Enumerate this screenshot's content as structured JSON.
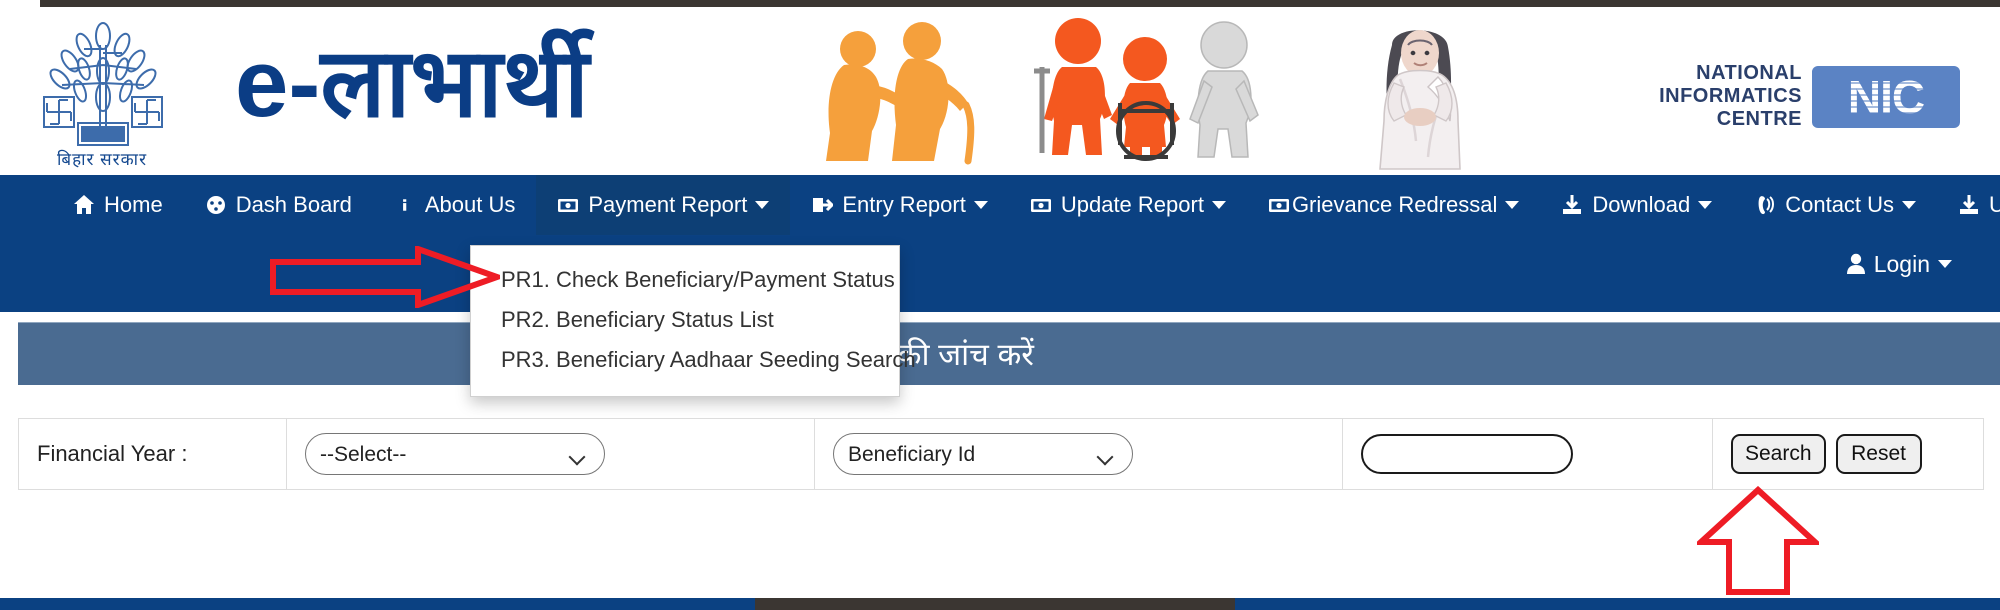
{
  "site": {
    "emblem_caption": "बिहार  सरकार",
    "brand_prefix": "e",
    "brand_dash": "-",
    "brand_hindi": "लाभार्थी",
    "nic_line1": "NATIONAL",
    "nic_line2": "INFORMATICS",
    "nic_line3": "CENTRE",
    "nic_mark": "NIC"
  },
  "nav": {
    "items": [
      {
        "label": "Home",
        "icon": "home-icon",
        "caret": false,
        "active": false
      },
      {
        "label": "Dash Board",
        "icon": "dashboard-icon",
        "caret": false,
        "active": false
      },
      {
        "label": "About Us",
        "icon": "info-icon",
        "caret": false,
        "active": false
      },
      {
        "label": "Payment Report",
        "icon": "money-icon",
        "caret": true,
        "active": true
      },
      {
        "label": "Entry Report",
        "icon": "signin-icon",
        "caret": true,
        "active": false
      },
      {
        "label": "Update Report",
        "icon": "money-icon",
        "caret": true,
        "active": false
      },
      {
        "label": "Grievance Redressal",
        "icon": "money-icon",
        "caret": true,
        "active": false
      },
      {
        "label": "Download",
        "icon": "download-icon",
        "caret": true,
        "active": false
      },
      {
        "label": "Contact Us",
        "icon": "phone-icon",
        "caret": true,
        "active": false
      },
      {
        "label": "User Manual",
        "icon": "download-icon",
        "caret": true,
        "active": false
      }
    ],
    "login_label": "Login",
    "login_icon": "user-icon"
  },
  "dropdown": {
    "open_for": "Payment Report",
    "items": [
      "PR1. Check Beneficiary/Payment Status",
      "PR2. Beneficiary Status List",
      "PR3. Beneficiary Aadhaar Seeding Search"
    ]
  },
  "page_title": "लाभार्थी भुगतान स्थिति की जांच करें",
  "form": {
    "financial_year_label": "Financial Year :",
    "financial_year_value": "--Select--",
    "financial_year_options": [
      "--Select--"
    ],
    "search_type_value": "Beneficiary Id",
    "search_type_options": [
      "Beneficiary Id"
    ],
    "search_value": "",
    "search_placeholder": "",
    "search_button": "Search",
    "reset_button": "Reset"
  },
  "annotations": {
    "arrow_right_target": "PR1. Check Beneficiary/Payment Status",
    "arrow_up_target": "Search",
    "arrow_color": "#ee1c25"
  },
  "colors": {
    "navbar": "#0b4182",
    "navbar_active": "#0d3f75",
    "titlebar": "#4a6b91",
    "brand_blue": "#0b3d85",
    "top_strip": "#3b3632",
    "accent_orange": "#f5a03c",
    "nic_blue": "#5b83c4"
  }
}
